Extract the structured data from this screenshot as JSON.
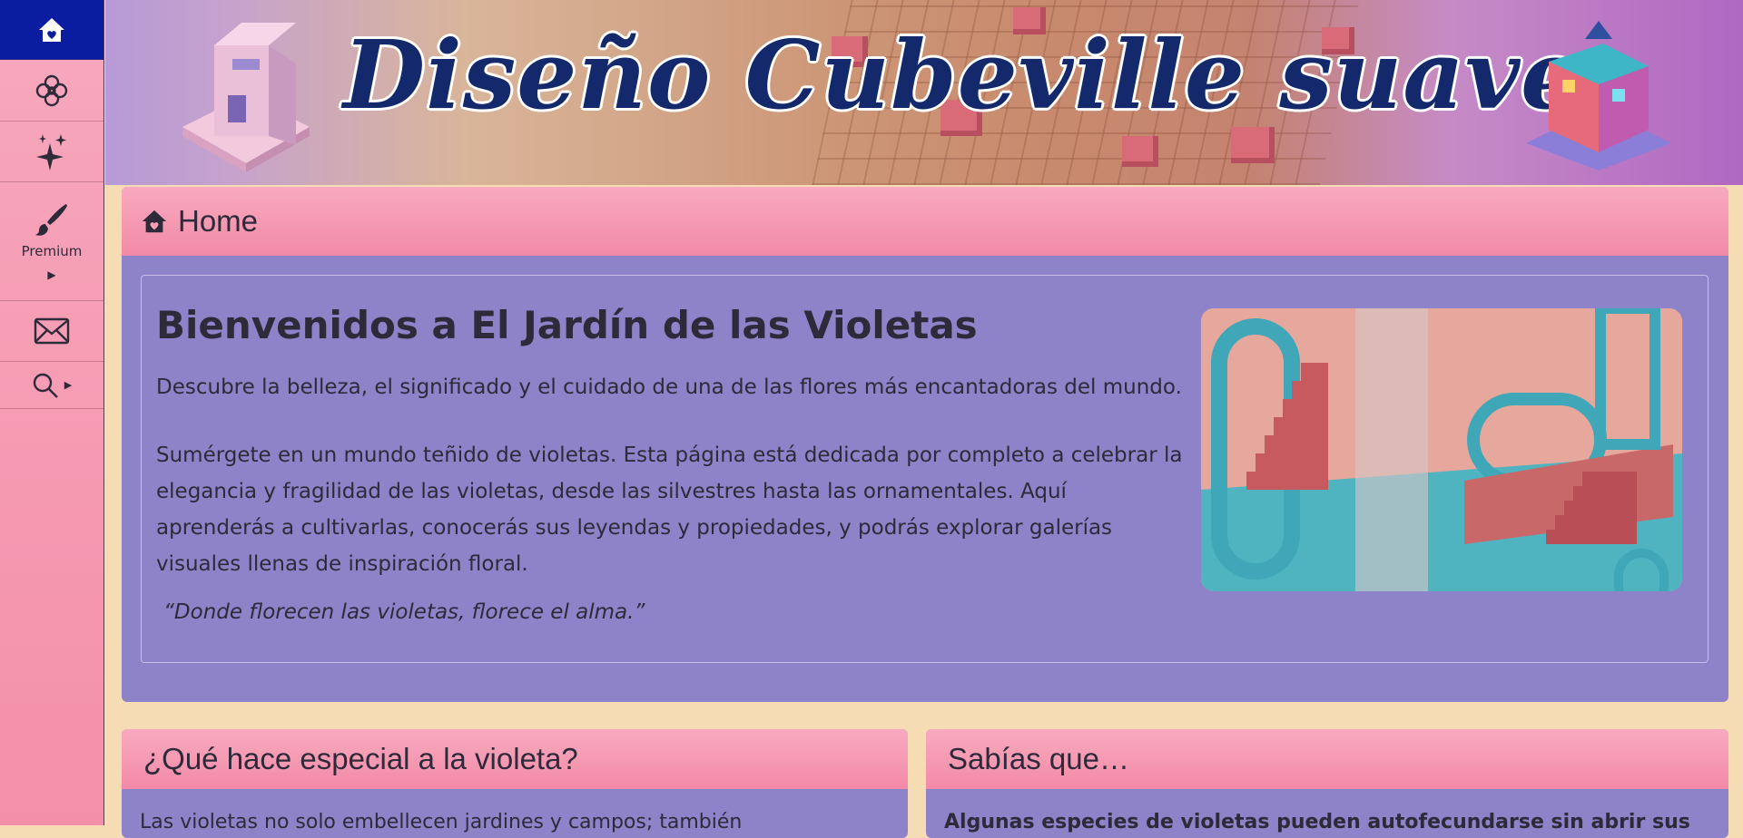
{
  "banner": {
    "title": "Diseño Cubeville suave."
  },
  "sidebar": {
    "items": [
      {
        "id": "home",
        "icon": "home-icon"
      },
      {
        "id": "flower",
        "icon": "flower-icon"
      },
      {
        "id": "sparkles",
        "icon": "sparkles-icon"
      },
      {
        "id": "premium",
        "icon": "paintbrush-icon",
        "label": "Premium"
      },
      {
        "id": "mail",
        "icon": "envelope-icon"
      },
      {
        "id": "search",
        "icon": "search-icon"
      }
    ]
  },
  "breadcrumb": {
    "label": "Home",
    "icon": "home-icon"
  },
  "hero": {
    "title": "Bienvenidos a El Jardín de las Violetas",
    "intro": "Descubre la belleza, el significado y el cuidado de una de las flores más encantadoras del mundo.",
    "body": "Sumérgete en un mundo teñido de violetas. Esta página está dedicada por completo a celebrar la elegancia y fragilidad de las violetas, desde las silvestres hasta las ornamentales. Aquí aprenderás a cultivarlas, conocerás sus leyendas y propiedades, y podrás explorar galerías visuales llenas de inspiración floral.",
    "quote": "“Donde florecen las violetas, florece el alma.”"
  },
  "sections": [
    {
      "title": "¿Qué hace especial a la violeta?",
      "text": "Las violetas no solo embellecen jardines y campos; también"
    },
    {
      "title": "Sabías que…",
      "text": "Algunas especies de violetas pueden autofecundarse sin abrir sus"
    }
  ],
  "colors": {
    "sidebar_pink": "#f48fa9",
    "home_active": "#0a1ca0",
    "panel_purple": "#8e83c8",
    "page_background": "#f6dcb4",
    "title_navy": "#14296b"
  }
}
